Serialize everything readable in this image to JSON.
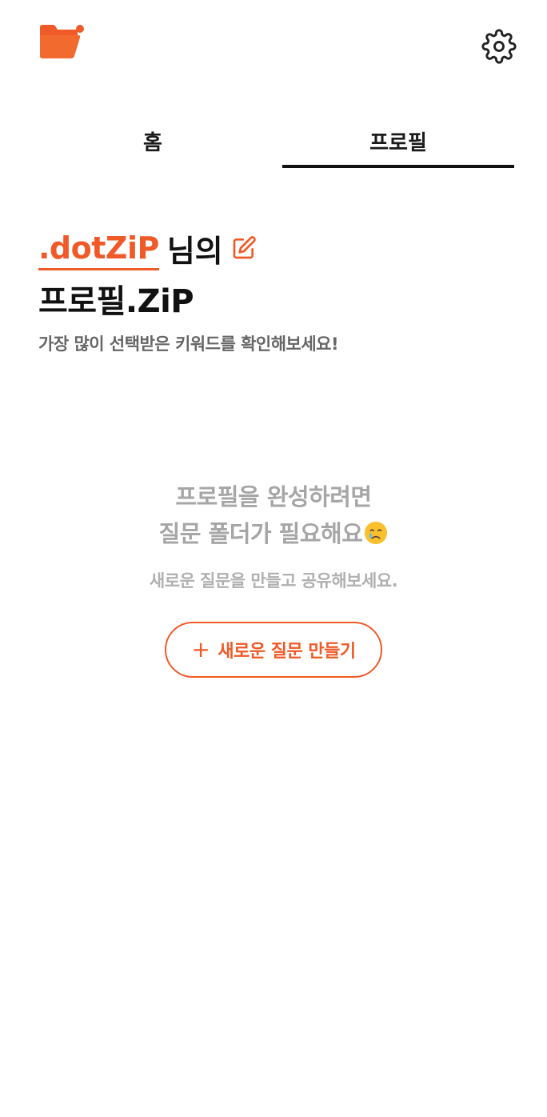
{
  "header": {
    "logo_icon": "folder-logo-icon",
    "settings_icon": "gear-icon"
  },
  "tabs": [
    {
      "label": "홈",
      "active": false
    },
    {
      "label": "프로필",
      "active": true
    }
  ],
  "profile": {
    "nickname": ".dotZiP",
    "nickname_suffix": "님의",
    "title": "프로필.ZiP",
    "description": "가장 많이 선택받은 키워드를 확인해보세요!",
    "edit_icon": "pencil-edit-icon"
  },
  "empty_state": {
    "line1": "프로필을 완성하려면",
    "line2": "질문 폴더가 필요해요",
    "emoji_icon": "crying-face-icon",
    "subtitle": "새로운 질문을 만들고 공유해보세요."
  },
  "create_button": {
    "label": "새로운 질문 만들기",
    "icon": "plus-icon"
  },
  "colors": {
    "accent": "#f05a28",
    "text_primary": "#111111",
    "text_muted": "#a6a6a6"
  }
}
